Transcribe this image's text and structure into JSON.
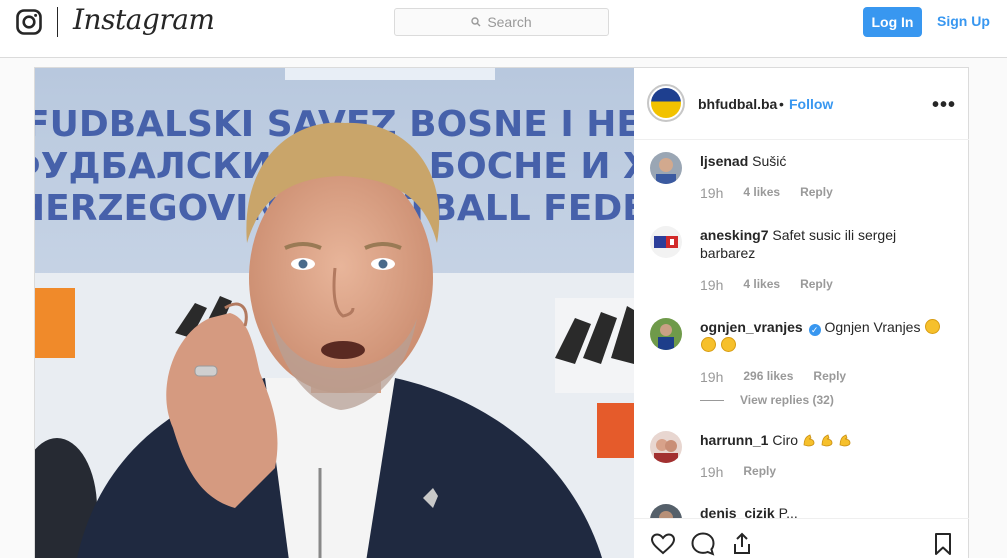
{
  "nav": {
    "wordmark": "Instagram",
    "search_placeholder": "Search",
    "login_label": "Log In",
    "signup_label": "Sign Up"
  },
  "post": {
    "username": "bhfudbal.ba",
    "separator": "•",
    "follow_label": "Follow",
    "more_label": "•••",
    "photo_banner_lines": [
      "FUDBALSKI SAVEZ BOSNE I HERCEGOVINE",
      "ФУДБАЛСКИ САВЕЗ БОСНЕ И ХЕРЦЕГОВИНЕ",
      "HERZEGOVINA FOOTBALL FEDERATION"
    ]
  },
  "comments": [
    {
      "user": "ljsenad",
      "text": "Sušić",
      "time": "19h",
      "likes": "4 likes",
      "reply": "Reply"
    },
    {
      "user": "anesking7",
      "text": "Safet susic ili sergej barbarez",
      "time": "19h",
      "likes": "4 likes",
      "reply": "Reply"
    },
    {
      "user": "ognjen_vranjes",
      "text": "Ognjen Vranjes",
      "time": "19h",
      "likes": "296 likes",
      "reply": "Reply",
      "view_replies": "View replies (32)"
    },
    {
      "user": "harrunn_1",
      "text": "Ciro",
      "time": "19h",
      "reply": "Reply"
    },
    {
      "user": "denis_cizik",
      "text": "P..."
    }
  ],
  "icons": {
    "brand": "instagram-glyph-icon",
    "search": "search-icon",
    "like": "heart-icon",
    "comment": "comment-icon",
    "share": "share-icon",
    "save": "bookmark-icon"
  },
  "colors": {
    "accent": "#3897f0",
    "border": "#dbdbdb",
    "muted": "#999999"
  }
}
